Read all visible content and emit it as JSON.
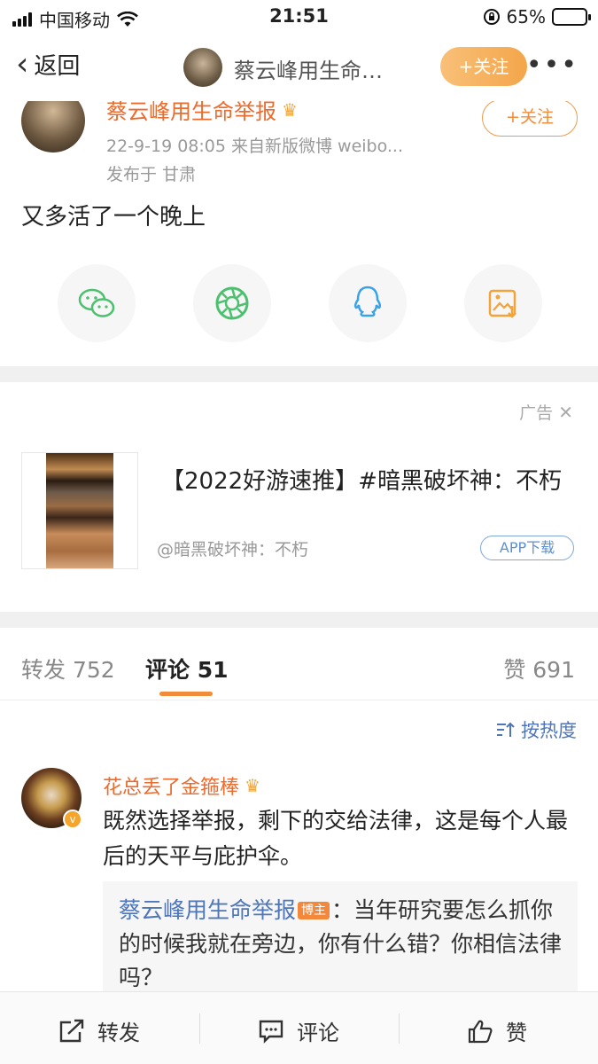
{
  "status_bar": {
    "carrier": "中国移动",
    "time": "21:51",
    "battery": "65%",
    "battery_level": 0.65
  },
  "navbar": {
    "back_label": "返回",
    "title": "蔡云峰用生命…",
    "follow_label": "+关注"
  },
  "post": {
    "author": "蔡云峰用生命举报",
    "meta": "22-9-19 08:05  来自新版微博 weibo...",
    "location": "发布于 甘肃",
    "follow_label": "+关注",
    "text": "又多活了一个晚上"
  },
  "share": {
    "icons": [
      "wechat-icon",
      "moments-icon",
      "qq-icon",
      "save-image-icon"
    ]
  },
  "ad": {
    "label": "广告",
    "title": "【2022好游速推】#暗黑破坏神：不朽",
    "source": "@暗黑破坏神：不朽",
    "button": "APP下载"
  },
  "tabs": {
    "repost": "转发 752",
    "comments": "评论 51",
    "likes": "赞 691"
  },
  "sort": {
    "label": "按热度"
  },
  "comment": {
    "name": "花总丢了金箍棒",
    "text": "既然选择举报，剩下的交给法律，这是每个人最后的天平与庇护伞。",
    "reply_name": "蔡云峰用生命举报",
    "reply_badge": "博主",
    "reply_text": "：当年研究要怎么抓你的时候我就在旁边，你有什么错？你相信法律吗？"
  },
  "bottom_bar": {
    "repost": "转发",
    "comment": "评论",
    "like": "赞"
  },
  "colors": {
    "accent_orange": "#f08c3a",
    "name_orange": "#ec6b2d",
    "link_blue": "#4f76b8"
  }
}
